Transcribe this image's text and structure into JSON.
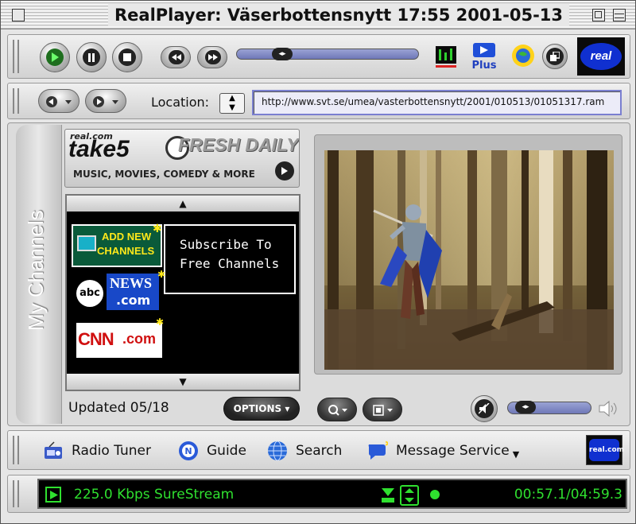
{
  "window": {
    "title": "RealPlayer: Väserbottensnytt 17:55 2001-05-13"
  },
  "controls": {
    "play_icon": "play-icon",
    "pause_icon": "pause-icon",
    "stop_icon": "stop-icon",
    "rewind_icon": "rewind-icon",
    "fastforward_icon": "fast-forward-icon",
    "playback_position_fraction": 0.22,
    "real_logo": "real"
  },
  "location": {
    "label": "Location:",
    "url": "http://www.svt.se/umea/vasterbottensnytt/2001/010513/01051317.ram"
  },
  "channels": {
    "tab_label": "My Channels",
    "take5": {
      "brand": "real.com",
      "title": "take5",
      "headline": "FRESH DAILY!",
      "tagline": "MUSIC, MOVIES, COMEDY & MORE"
    },
    "add_new": {
      "line1": "ADD NEW",
      "line2": "CHANNELS"
    },
    "callout": {
      "line1": "Subscribe To",
      "line2": "Free Channels"
    },
    "abc": {
      "abc": "abc",
      "news": "NEWS",
      "com": ".com"
    },
    "cnn": {
      "text": "CNN",
      "com": ".com"
    },
    "updated": "Updated 05/18",
    "options_label": "OPTIONS"
  },
  "volume": {
    "level_fraction": 0.12
  },
  "nav": {
    "radio_tuner": "Radio Tuner",
    "guide": "Guide",
    "search": "Search",
    "message_service": "Message Service",
    "badge": "real.com"
  },
  "status": {
    "stream": "225.0 Kbps SureStream",
    "time": "00:57.1/04:59.3"
  },
  "colors": {
    "status_green": "#2fe02f",
    "accent_blue": "#7a7fd0",
    "real_blue": "#1030d0"
  }
}
